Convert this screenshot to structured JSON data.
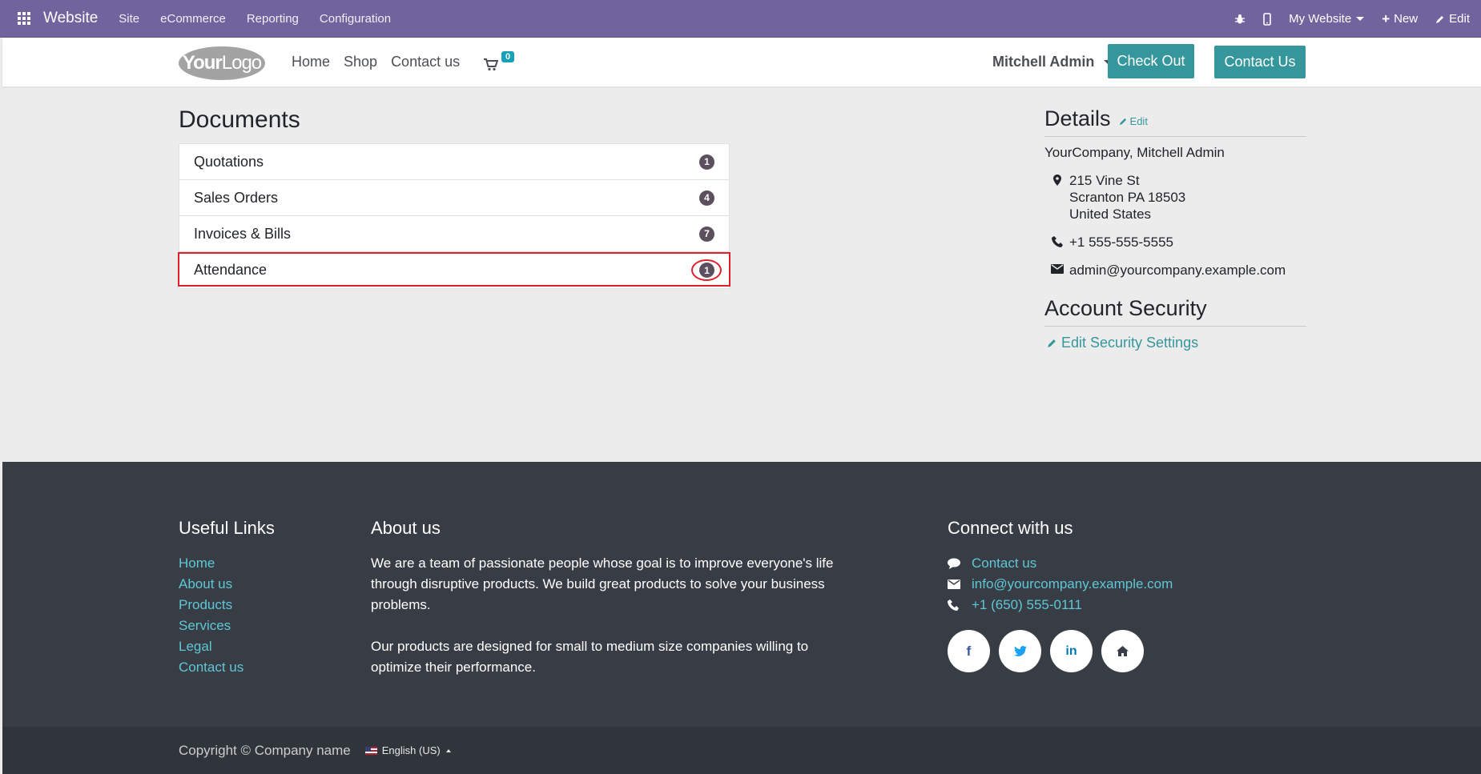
{
  "topbar": {
    "brand": "Website",
    "menu": [
      "Site",
      "eCommerce",
      "Reporting",
      "Configuration"
    ],
    "my_website": "My Website",
    "new_label": "New",
    "edit_label": "Edit"
  },
  "header": {
    "logo_bold": "Your",
    "logo_thin": "Logo",
    "nav": [
      "Home",
      "Shop",
      "Contact us"
    ],
    "cart_count": "0",
    "user_name": "Mitchell Admin",
    "checkout_label": "Check Out",
    "contact_label": "Contact Us"
  },
  "documents": {
    "title": "Documents",
    "rows": [
      {
        "label": "Quotations",
        "count": "1"
      },
      {
        "label": "Sales Orders",
        "count": "4"
      },
      {
        "label": "Invoices & Bills",
        "count": "7"
      },
      {
        "label": "Attendance",
        "count": "1"
      }
    ]
  },
  "details": {
    "title": "Details",
    "edit_label": "Edit",
    "company": "YourCompany, Mitchell Admin",
    "address_line1": "215 Vine St",
    "address_line2": "Scranton PA 18503",
    "address_line3": "United States",
    "phone": "+1 555-555-5555",
    "email": "admin@yourcompany.example.com",
    "security_title": "Account Security",
    "security_link": "Edit Security Settings"
  },
  "footer": {
    "useful_title": "Useful Links",
    "useful_links": [
      "Home",
      "About us",
      "Products",
      "Services",
      "Legal",
      "Contact us"
    ],
    "about_title": "About us",
    "about_p1": "We are a team of passionate people whose goal is to improve everyone's life through disruptive products. We build great products to solve your business problems.",
    "about_p2": "Our products are designed for small to medium size companies willing to optimize their performance.",
    "connect_title": "Connect with us",
    "connect_contact": "Contact us",
    "connect_email": "info@yourcompany.example.com",
    "connect_phone": "+1 (650) 555-0111",
    "copyright": "Copyright © Company name",
    "language": "English (US)"
  },
  "colors": {
    "topbar": "#71639e",
    "accent": "#35979c",
    "footer": "#383d45",
    "highlight": "#e0202b"
  }
}
